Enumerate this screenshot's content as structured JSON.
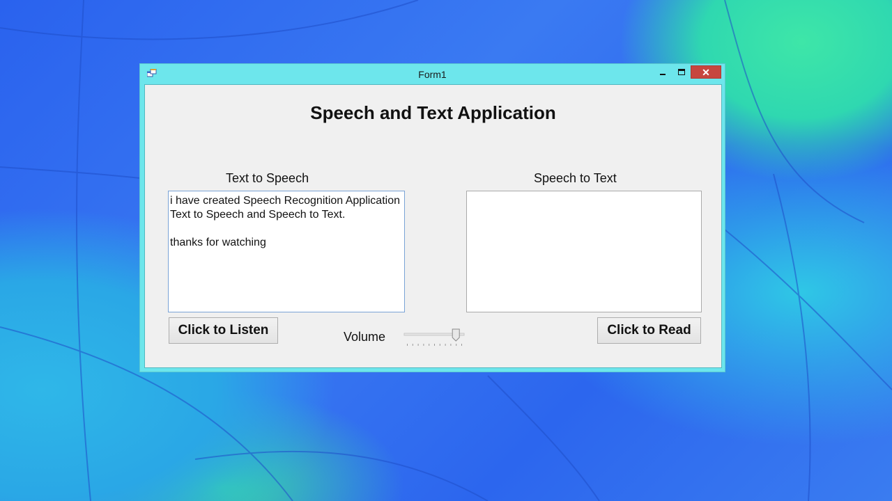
{
  "window": {
    "title": "Form1",
    "icon": "app-window-icon",
    "controls": {
      "minimize": "minimize-icon",
      "maximize": "maximize-icon",
      "close": "✕"
    }
  },
  "app": {
    "heading": "Speech and Text Application",
    "text_to_speech": {
      "label": "Text to Speech",
      "lines": [
        "i have created Speech Recognition Application",
        "Text to Speech and Speech to Text.",
        "",
        "thanks for watching"
      ],
      "button": "Click to Listen"
    },
    "speech_to_text": {
      "label": "Speech to Text",
      "value": "",
      "button": "Click to Read"
    },
    "volume": {
      "label": "Volume",
      "level": 0.9
    }
  },
  "colors": {
    "titlebar": "#6de6ec",
    "close_button": "#c7463f",
    "client_bg": "#f0f0f0"
  }
}
